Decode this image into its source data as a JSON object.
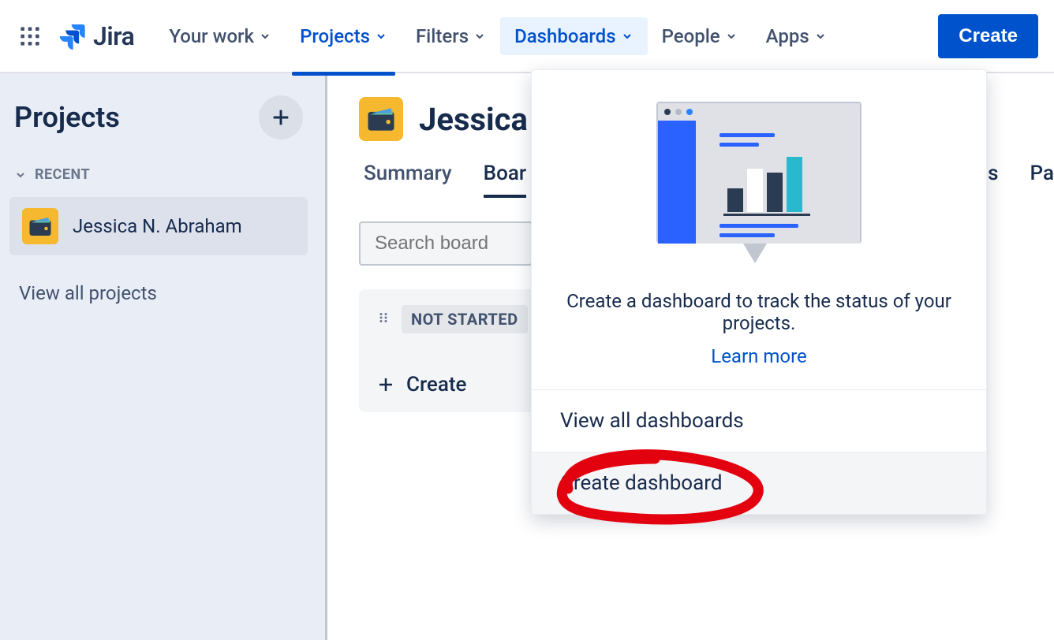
{
  "brand": "Jira",
  "nav": {
    "your_work": "Your work",
    "projects": "Projects",
    "filters": "Filters",
    "dashboards": "Dashboards",
    "people": "People",
    "apps": "Apps",
    "create": "Create"
  },
  "sidebar": {
    "title": "Projects",
    "recent_label": "RECENT",
    "project_name": "Jessica N. Abraham",
    "view_all": "View all projects"
  },
  "main": {
    "title": "Jessica",
    "tabs": {
      "summary": "Summary",
      "board": "Boar",
      "right_cut_1": "s",
      "right_cut_2": "Pa"
    },
    "search_placeholder": "Search board",
    "column": {
      "status": "NOT STARTED",
      "create": "Create"
    }
  },
  "dropdown": {
    "message": "Create a dashboard to track the status of your projects.",
    "learn_more": "Learn more",
    "view_all": "View all dashboards",
    "create": "Create dashboard"
  }
}
